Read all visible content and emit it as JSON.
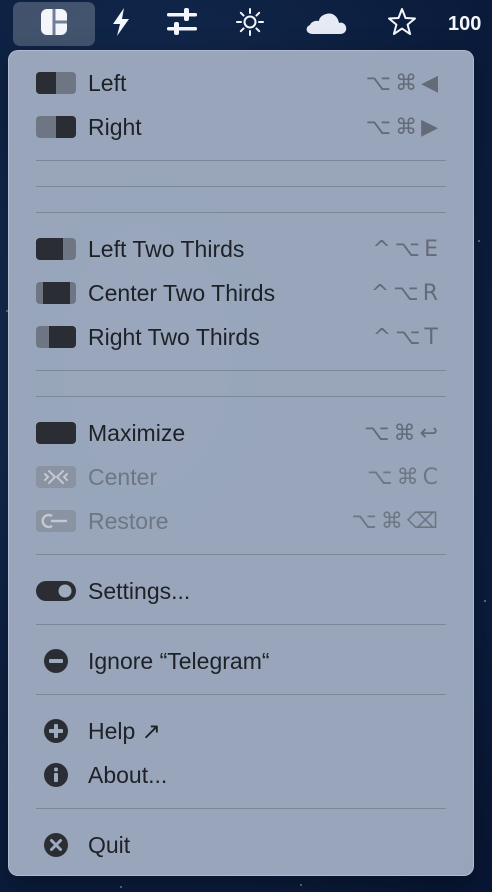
{
  "menubar": {
    "battery_text": "100",
    "icons": [
      "rectangle-app-icon",
      "bolt-icon",
      "sliders-icon",
      "brightness-icon",
      "cloud-icon",
      "star-icon"
    ]
  },
  "menu": {
    "left": {
      "label": "Left",
      "shortcut": "⌥⌘◀"
    },
    "right": {
      "label": "Right",
      "shortcut": "⌥⌘▶"
    },
    "left_two_thirds": {
      "label": "Left Two Thirds",
      "shortcut": "^⌥E"
    },
    "center_two_thirds": {
      "label": "Center Two Thirds",
      "shortcut": "^⌥R"
    },
    "right_two_thirds": {
      "label": "Right Two Thirds",
      "shortcut": "^⌥T"
    },
    "maximize": {
      "label": "Maximize",
      "shortcut": "⌥⌘↩"
    },
    "center": {
      "label": "Center",
      "shortcut": "⌥⌘C"
    },
    "restore": {
      "label": "Restore",
      "shortcut": "⌥⌘⌫"
    },
    "settings": {
      "label": "Settings..."
    },
    "ignore": {
      "label": "Ignore “Telegram“"
    },
    "help": {
      "label": "Help ↗"
    },
    "about": {
      "label": "About..."
    },
    "quit": {
      "label": "Quit"
    }
  },
  "colors": {
    "menu_bg": "#9eabbf",
    "icon_dark": "#2a2d33",
    "icon_light": "#6e7684",
    "text": "#1e2126",
    "shortcut": "#636b78"
  }
}
